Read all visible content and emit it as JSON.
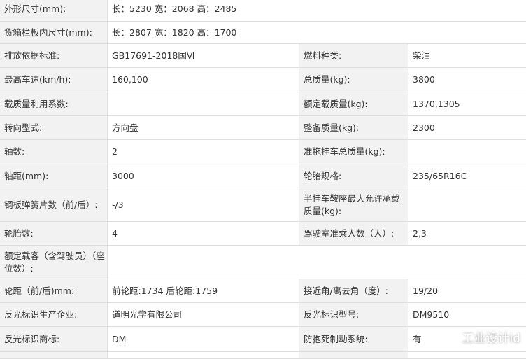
{
  "rows": [
    {
      "l1": "外形尺寸(mm):",
      "v1": "长：5230 宽：2068 高：2485"
    },
    {
      "l1": "货箱栏板内尺寸(mm):",
      "v1": "长：2807 宽：1820 高：1700"
    },
    {
      "l1": "排放依据标准:",
      "v1": "GB17691-2018国Ⅵ",
      "l2": "燃料种类:",
      "v2": "柴油"
    },
    {
      "l1": "最高车速(km/h):",
      "v1": "160,100",
      "l2": "总质量(kg):",
      "v2": "3800"
    },
    {
      "l1": "载质量利用系数:",
      "v1": "",
      "l2": "额定载质量(kg):",
      "v2": "1370,1305"
    },
    {
      "l1": "转向型式:",
      "v1": "方向盘",
      "l2": "整备质量(kg):",
      "v2": "2300"
    },
    {
      "l1": "轴数:",
      "v1": "2",
      "l2": "准拖挂车总质量(kg):",
      "v2": ""
    },
    {
      "l1": "轴距(mm):",
      "v1": "3000",
      "l2": "轮胎规格:",
      "v2": "235/65R16C"
    },
    {
      "l1": "钢板弹簧片数（前/后）:",
      "v1": "-/3",
      "l2": "半挂车鞍座最大允许承载质量(kg):",
      "v2": ""
    },
    {
      "l1": "轮胎数:",
      "v1": "4",
      "l2": "驾驶室准乘人数（人）:",
      "v2": "2,3"
    },
    {
      "l1": "额定载客（含驾驶员）（座位数）:",
      "v1": ""
    },
    {
      "l1": "轮距（前/后)mm:",
      "v1": "前轮距:1734 后轮距:1759",
      "l2": "接近角/离去角（度）:",
      "v2": "19/20"
    },
    {
      "l1": "反光标识生产企业:",
      "v1": "道明光学有限公司",
      "l2": "反光标识型号:",
      "v2": "DM9510"
    },
    {
      "l1": "反光标识商标:",
      "v1": "DM",
      "l2": "防抱死制动系统:",
      "v2": "有"
    }
  ],
  "watermark": {
    "text": "工业设计id",
    "icon": "wechat-icon"
  }
}
